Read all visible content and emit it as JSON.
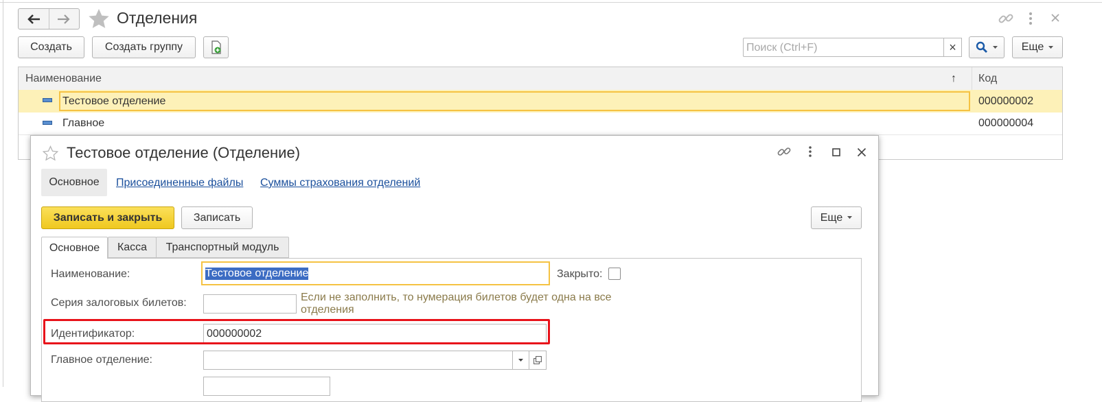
{
  "list_window": {
    "title": "Отделения",
    "nav": {
      "back_glyph": "🡐",
      "forward_glyph": "🡒"
    },
    "toolbar": {
      "create_label": "Создать",
      "create_group_label": "Создать группу",
      "search_placeholder": "Поиск (Ctrl+F)",
      "search_clear_glyph": "×",
      "more_label": "Еще"
    },
    "table": {
      "columns": [
        {
          "label": "Наименование",
          "sort_glyph": "↑"
        },
        {
          "label": "Код"
        }
      ],
      "rows": [
        {
          "name": "Тестовое отделение",
          "code": "000000002",
          "selected": true
        },
        {
          "name": "Главное",
          "code": "000000004",
          "selected": false
        }
      ]
    }
  },
  "form": {
    "title": "Тестовое отделение (Отделение)",
    "nav_tabs": [
      {
        "label": "Основное",
        "active": true
      },
      {
        "label": "Присоединенные файлы",
        "active": false
      },
      {
        "label": "Суммы страхования отделений",
        "active": false
      }
    ],
    "toolbar": {
      "save_close_label": "Записать и закрыть",
      "save_label": "Записать",
      "more_label": "Еще"
    },
    "tabs": [
      {
        "label": "Основное",
        "active": true
      },
      {
        "label": "Касса",
        "active": false
      },
      {
        "label": "Транспортный модуль",
        "active": false
      }
    ],
    "fields": {
      "name_label": "Наименование:",
      "name_value": "Тестовое отделение",
      "closed_label": "Закрыто:",
      "series_label": "Серия залоговых билетов:",
      "series_value": "",
      "series_hint": "Если не заполнить, то нумерация билетов будет одна на все отделения",
      "id_label": "Идентификатор:",
      "id_value": "000000002",
      "main_branch_label": "Главное отделение:",
      "main_branch_value": ""
    }
  },
  "colors": {
    "selection": "#fdf1b8",
    "selected_cell_border": "#f5c242",
    "primary_button": "#f6d42b",
    "highlight_frame": "#e8121a",
    "link": "#1a4f9c"
  }
}
